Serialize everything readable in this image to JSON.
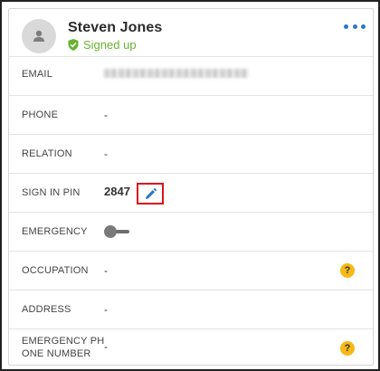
{
  "contact": {
    "name": "Steven Jones",
    "status": "Signed up",
    "status_color": "#66b32e",
    "accent_color": "#2a78c7"
  },
  "icons": {
    "avatar": "person-icon",
    "status": "shield-check-icon",
    "more": "more-horizontal-icon",
    "edit": "pencil-icon",
    "help": "question-icon"
  },
  "fields": {
    "email": {
      "label": "EMAIL"
    },
    "phone": {
      "label": "PHONE",
      "value": "-"
    },
    "relation": {
      "label": "RELATION",
      "value": "-"
    },
    "sign_in_pin": {
      "label": "SIGN IN PIN",
      "value": "2847"
    },
    "emergency": {
      "label": "EMERGENCY",
      "state": "off"
    },
    "occupation": {
      "label": "OCCUPATION",
      "value": "-",
      "help": "?"
    },
    "address": {
      "label": "ADDRESS",
      "value": "-"
    },
    "emergency_phone": {
      "label": "EMERGENCY PH ONE NUMBER",
      "value": "-",
      "help": "?"
    }
  }
}
